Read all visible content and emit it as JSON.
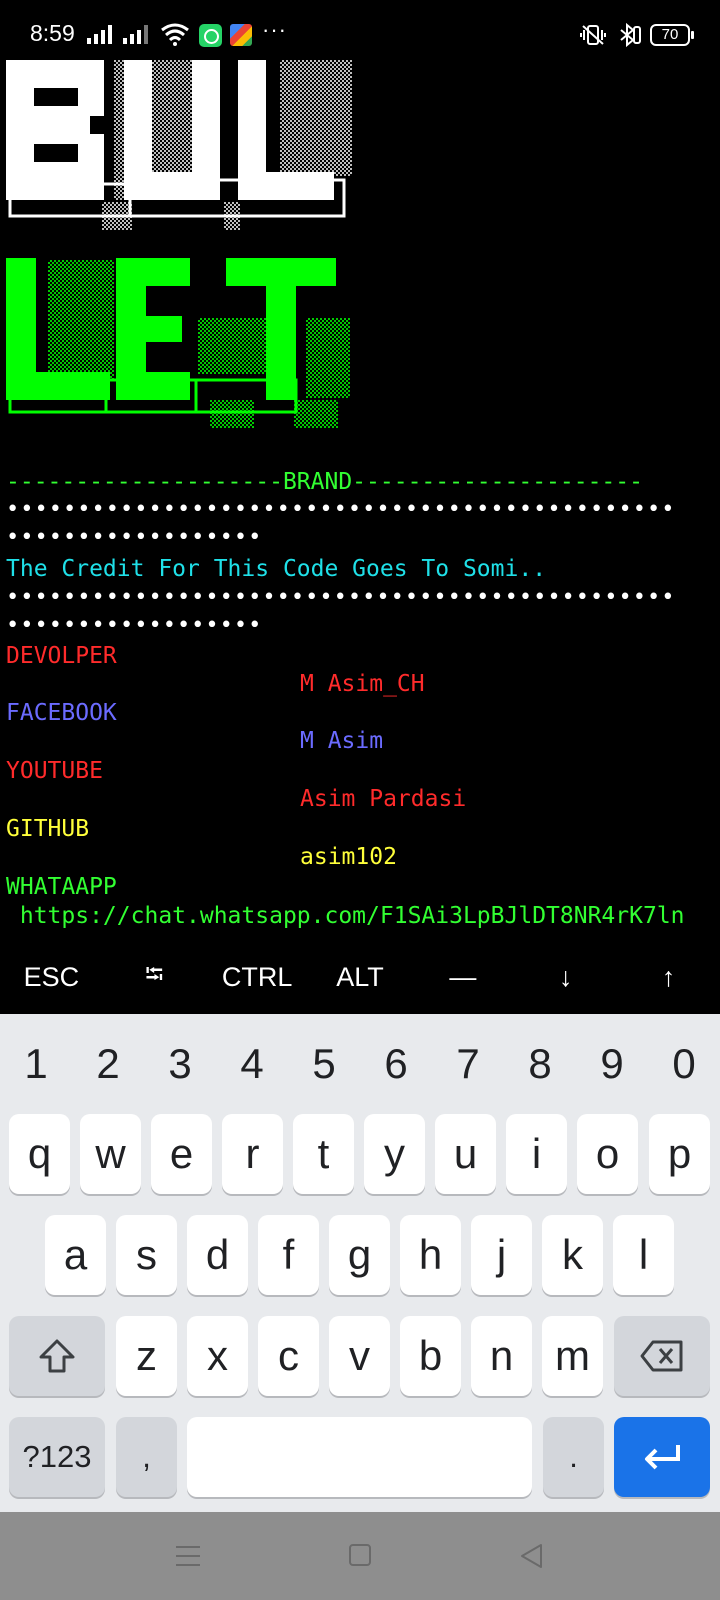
{
  "status_bar": {
    "time": "8:59",
    "battery": "70",
    "more": "···"
  },
  "banner": {
    "line1": "BUL",
    "line2": "LET"
  },
  "terminal": {
    "brand_line": "--------------------BRAND---------------------",
    "dots_long": "•••••••••••••••••••••••••••••••••••••••••••••••",
    "dots_short": "••••••••••••••••••",
    "credit": "The Credit For This Code Goes To Somi..",
    "devolper_label": "DEVOLPER",
    "devolper_value": "M Asim_CH",
    "facebook_label": "FACEBOOK",
    "facebook_value": "M Asim",
    "youtube_label": "YOUTUBE",
    "youtube_value": "Asim Pardasi",
    "github_label": "GITHUB",
    "github_value": "asim102",
    "whatsapp_label": "WHATAAPP",
    "whatsapp_value": " https://chat.whatsapp.com/F1SAi3LpBJlDT8NR4rK7ln"
  },
  "extra_keys": [
    "ESC",
    "⭾",
    "CTRL",
    "ALT",
    "—",
    "↓",
    "↑"
  ],
  "keyboard": {
    "numbers": [
      "1",
      "2",
      "3",
      "4",
      "5",
      "6",
      "7",
      "8",
      "9",
      "0"
    ],
    "row1": [
      "q",
      "w",
      "e",
      "r",
      "t",
      "y",
      "u",
      "i",
      "o",
      "p"
    ],
    "row2": [
      "a",
      "s",
      "d",
      "f",
      "g",
      "h",
      "j",
      "k",
      "l"
    ],
    "row3": [
      "z",
      "x",
      "c",
      "v",
      "b",
      "n",
      "m"
    ],
    "symbols_key": "?123",
    "comma_key": ",",
    "period_key": "."
  },
  "colors": {
    "terminal_bg": "#000000",
    "banner_green": "#00ff00",
    "enter_blue": "#1a73e8"
  }
}
